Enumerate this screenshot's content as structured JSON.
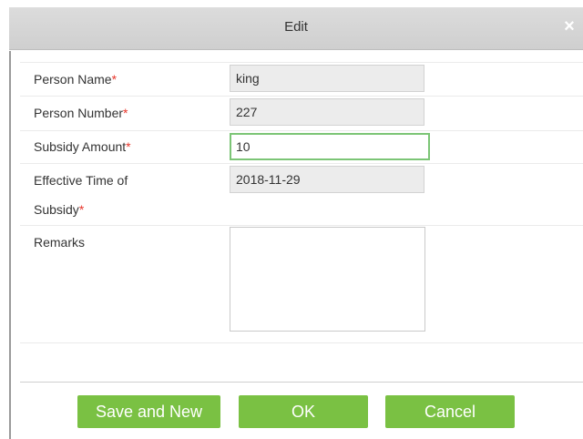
{
  "dialog": {
    "title": "Edit",
    "close_symbol": "×"
  },
  "form": {
    "person_name": {
      "label": "Person Name",
      "required_mark": "*",
      "value": "king"
    },
    "person_number": {
      "label": "Person Number",
      "required_mark": "*",
      "value": "227"
    },
    "subsidy_amount": {
      "label": "Subsidy Amount",
      "required_mark": "*",
      "value": "10"
    },
    "effective_time": {
      "label_line1": "Effective Time of",
      "label_line2": "Subsidy",
      "required_mark": "*",
      "value": "2018-11-29"
    },
    "remarks": {
      "label": "Remarks",
      "value": ""
    }
  },
  "buttons": {
    "save_and_new": "Save and New",
    "ok": "OK",
    "cancel": "Cancel"
  },
  "colors": {
    "button_green": "#7ac143",
    "required_red": "#e8362b",
    "active_border": "#7cc576"
  },
  "icons": {
    "close": "close-icon"
  }
}
